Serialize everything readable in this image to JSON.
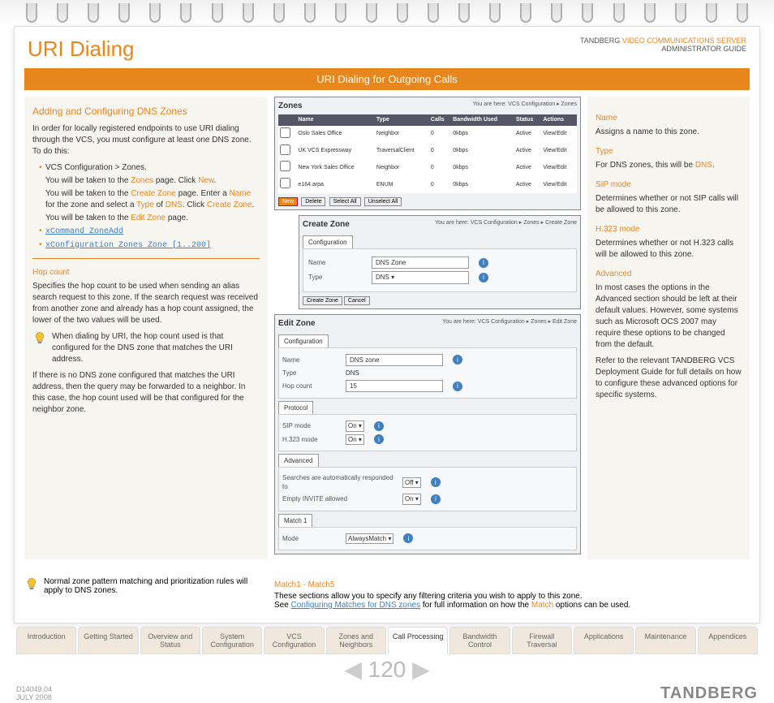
{
  "header": {
    "title": "URI Dialing",
    "brand_prefix": "TANDBERG",
    "brand_product": "VIDEO COMMUNICATIONS SERVER",
    "brand_sub": "ADMINISTRATOR GUIDE"
  },
  "bar": "URI Dialing for Outgoing Calls",
  "left": {
    "heading": "Adding and Configuring DNS Zones",
    "intro": "In order for locally registered endpoints to use URI dialing through the VCS, you must configure at least one DNS zone. To do this:",
    "items": [
      {
        "text": "VCS Configuration > Zones",
        "link": false
      },
      {
        "text_pre": "You will be taken to the ",
        "link": "Zones",
        "text_post": " page. Click ",
        "link2": "New",
        "suffix": "."
      },
      {
        "text_pre": "You will be taken to the ",
        "link": "Create Zone",
        "text_post": " page. Enter a ",
        "link2": "Name",
        "mid": " for the zone and select a ",
        "link3": "Type",
        "mid2": " of ",
        "link4": "DNS",
        "suffix": ". Click ",
        "link5": "Create Zone",
        "suffix2": "."
      },
      {
        "text_pre": "You will be taken to the ",
        "link": "Edit Zone",
        "text_post": " page."
      }
    ],
    "cmd1": "xCommand ZoneAdd",
    "cmd2": "xConfiguration Zones Zone [1..200]",
    "hop_title": "Hop count",
    "hop_p1": "Specifies the hop count to be used when sending an alias search request to this zone. If the search request was received from another zone and already has a hop count assigned, the lower of the two values will be used.",
    "hop_tip": "When dialing by URI, the hop count used is that configured for the DNS zone that matches the URI address.",
    "hop_p2": "If there is no DNS zone configured that matches the URI address, then the query may be forwarded to a neighbor. In this case, the hop count used will be that configured for the neighbor zone."
  },
  "middle": {
    "zones": {
      "title": "Zones",
      "crumb": "You are here: VCS Configuration ▸ Zones",
      "headers": [
        "",
        "Name",
        "Type",
        "Calls",
        "Bandwidth Used",
        "Status",
        "Actions"
      ],
      "rows": [
        [
          "",
          "Oslo Sales Office",
          "Neighbor",
          "0",
          "0kbps",
          "Active",
          "View/Edit"
        ],
        [
          "",
          "UK VCS Expressway",
          "TraversalClient",
          "0",
          "0kbps",
          "Active",
          "View/Edit"
        ],
        [
          "",
          "New York Sales Office",
          "Neighbor",
          "0",
          "0kbps",
          "Active",
          "View/Edit"
        ],
        [
          "",
          "e164.arpa",
          "ENUM",
          "0",
          "0kbps",
          "Active",
          "View/Edit"
        ]
      ],
      "buttons": [
        "New",
        "Delete",
        "Select All",
        "Unselect All"
      ]
    },
    "create": {
      "title": "Create Zone",
      "crumb": "You are here: VCS Configuration ▸ Zones ▸ Create Zone",
      "tab": "Configuration",
      "name_label": "Name",
      "name_val": "DNS Zone",
      "type_label": "Type",
      "type_val": "DNS",
      "btn1": "Create Zone",
      "btn2": "Cancel"
    },
    "edit": {
      "title": "Edit Zone",
      "crumb": "You are here: VCS Configuration ▸ Zones ▸ Edit Zone",
      "tab": "Configuration",
      "rows": [
        {
          "label": "Name",
          "val": "DNS zone",
          "type": "text"
        },
        {
          "label": "Type",
          "val": "DNS",
          "type": "static"
        },
        {
          "label": "Hop count",
          "val": "15",
          "type": "text"
        }
      ],
      "protocol_tab": "Protocol",
      "proto_rows": [
        {
          "label": "SIP mode",
          "val": "On"
        },
        {
          "label": "H.323 mode",
          "val": "On"
        }
      ],
      "adv_tab": "Advanced",
      "adv_rows": [
        {
          "label": "Searches are automatically responded to",
          "val": "Off"
        },
        {
          "label": "Empty INVITE allowed",
          "val": "On"
        }
      ],
      "match_tab": "Match 1",
      "match_rows": [
        {
          "label": "Mode",
          "val": "AlwaysMatch"
        }
      ]
    }
  },
  "right": {
    "items": [
      {
        "title": "Name",
        "body": "Assigns a name to this zone."
      },
      {
        "title": "Type",
        "body_pre": "For DNS zones, this will be ",
        "link": "DNS",
        "body_post": "."
      },
      {
        "title": "SIP mode",
        "body": "Determines whether or not SIP calls will be allowed to this zone."
      },
      {
        "title": "H.323 mode",
        "body": "Determines whether or not H.323 calls will be allowed to this zone."
      },
      {
        "title": "Advanced",
        "body": "In most cases the options in the Advanced section should be left at their default values. However, some systems such as Microsoft OCS 2007 may require these options to be changed from the default.",
        "body2": "Refer to the relevant TANDBERG VCS Deployment Guide for full details on how to configure these advanced options for specific systems."
      }
    ]
  },
  "foot": {
    "tip": "Normal zone pattern matching and prioritization rules will apply to DNS zones.",
    "match_title": "Match1 - Match5",
    "match_p1": "These sections allow you to specify any filtering criteria you wish to apply to this zone.",
    "match_p2_pre": "See ",
    "match_link": "Configuring Matches for DNS zones",
    "match_p2_mid": " for full information on how the ",
    "match_link2": "Match",
    "match_p2_post": " options can be used."
  },
  "tabs": [
    "Introduction",
    "Getting Started",
    "Overview and Status",
    "System Configuration",
    "VCS Configuration",
    "Zones and Neighbors",
    "Call Processing",
    "Bandwidth Control",
    "Firewall Traversal",
    "Applications",
    "Maintenance",
    "Appendices"
  ],
  "tabs_active": "Call Processing",
  "page_num": "120",
  "doc_id": "D14049.04",
  "doc_date": "JULY 2008",
  "brand_footer": "TANDBERG"
}
